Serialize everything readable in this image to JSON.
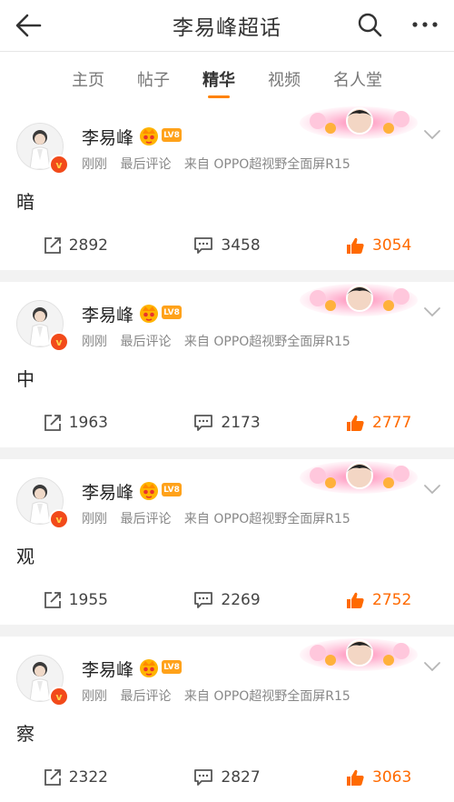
{
  "header": {
    "title": "李易峰超话"
  },
  "tabs": [
    {
      "label": "主页",
      "active": false
    },
    {
      "label": "帖子",
      "active": false
    },
    {
      "label": "精华",
      "active": true
    },
    {
      "label": "视频",
      "active": false
    },
    {
      "label": "名人堂",
      "active": false
    }
  ],
  "posts": [
    {
      "author": "李易峰",
      "level": "LV8",
      "time": "刚刚",
      "last_comment": "最后评论",
      "source": "来自 OPPO超视野全面屏R15",
      "text": "暗",
      "reposts": "2892",
      "comments": "3458",
      "likes": "3054"
    },
    {
      "author": "李易峰",
      "level": "LV8",
      "time": "刚刚",
      "last_comment": "最后评论",
      "source": "来自 OPPO超视野全面屏R15",
      "text": "中",
      "reposts": "1963",
      "comments": "2173",
      "likes": "2777"
    },
    {
      "author": "李易峰",
      "level": "LV8",
      "time": "刚刚",
      "last_comment": "最后评论",
      "source": "来自 OPPO超视野全面屏R15",
      "text": "观",
      "reposts": "1955",
      "comments": "2269",
      "likes": "2752"
    },
    {
      "author": "李易峰",
      "level": "LV8",
      "time": "刚刚",
      "last_comment": "最后评论",
      "source": "来自 OPPO超视野全面屏R15",
      "text": "察",
      "reposts": "2322",
      "comments": "2827",
      "likes": "3063"
    }
  ],
  "colors": {
    "accent": "#ff8200",
    "like": "#ff6a00",
    "verified": "#f24a1a",
    "level_badge": "#ffa21a"
  }
}
